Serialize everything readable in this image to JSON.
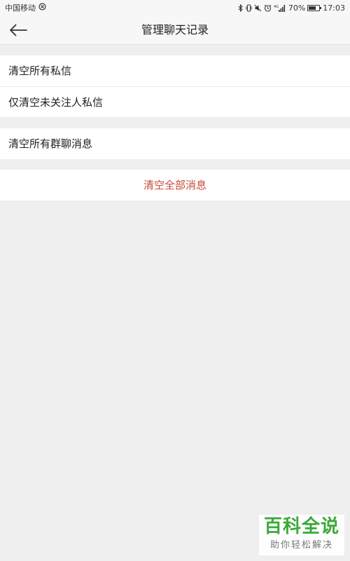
{
  "status_bar": {
    "carrier": "中国移动",
    "network_badge": "4G",
    "battery_text": "70%",
    "battery_level": 0.7,
    "time": "17:03"
  },
  "header": {
    "title": "管理聊天记录"
  },
  "private_messages_group": {
    "items": [
      {
        "label": "清空所有私信"
      },
      {
        "label": "仅清空未关注人私信"
      }
    ]
  },
  "group_chat_group": {
    "items": [
      {
        "label": "清空所有群聊消息"
      }
    ]
  },
  "clear_all_group": {
    "label": "清空全部消息",
    "color": "#c94a3a"
  },
  "watermark": {
    "title": "百科全说",
    "subtitle": "助你轻松解决"
  }
}
